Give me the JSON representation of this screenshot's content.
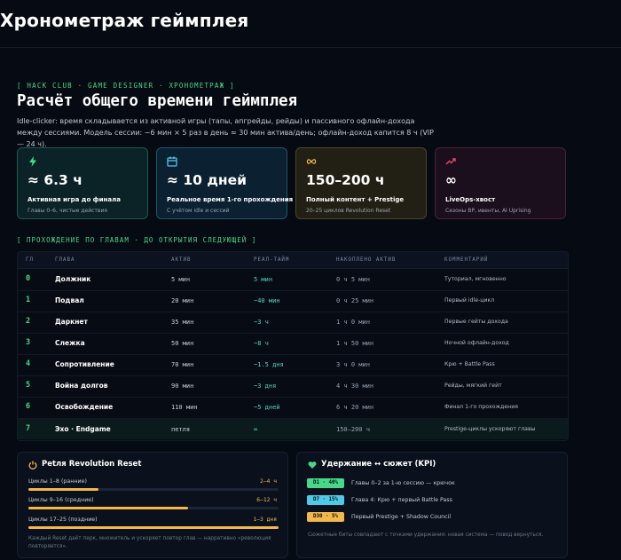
{
  "page_title": "Хронометраж геймплея",
  "eyebrow": "[ HACK CLUB · GAME DESIGNER · ХРОНОМЕТРАЖ ]",
  "title": "Расчёт общего времени геймплея",
  "intro": "Idle-clicker: время складывается из активной игры (тапы, апгрейды, рейды) и пассивного офлайн-дохода между сессиями. Модель сессии: ~6 мин × 5 раз в день ≈ 30 мин актива/день; офлайн-доход капится 8 ч (VIP — 24 ч).",
  "stats": [
    {
      "icon": "lightning-icon",
      "value": "≈ 6.3 ч",
      "label": "Активная игра до финала",
      "sub": "Главы 0–6, чистые действия",
      "accent": "#46d98a"
    },
    {
      "icon": "calendar-icon",
      "value": "≈ 10 дней",
      "label": "Реальное время 1-го прохождения",
      "sub": "С учётом idle и сессий",
      "accent": "#4fc9e6"
    },
    {
      "icon": "infinity-icon",
      "value": "150–200 ч",
      "label": "Полный контент + Prestige",
      "sub": "20–25 циклов Revolution Reset",
      "accent": "#f2b84b"
    },
    {
      "icon": "trending-up-icon",
      "value": "∞",
      "label": "LiveOps-хвост",
      "sub": "Сезоны BP, ивенты, AI Uprising",
      "accent": "#e8456b"
    }
  ],
  "section_label": "[ ПРОХОЖДЕНИЕ ПО ГЛАВАМ · ДО ОТКРЫТИЯ СЛЕДУЮЩЕЙ ]",
  "table": {
    "headers": [
      "ГЛ",
      "ГЛАВА",
      "АКТИВ",
      "РЕАЛ-ТАЙМ",
      "НАКОПЛЕНО АКТИВ",
      "КОММЕНТАРИЙ"
    ],
    "rows": [
      {
        "num": "0",
        "chapter": "Должник",
        "active": "5 мин",
        "realtime": "5 мин",
        "accum": "0 ч 5 мин",
        "comment": "Туториал, мгновенно"
      },
      {
        "num": "1",
        "chapter": "Подвал",
        "active": "20 мин",
        "realtime": "~40 мин",
        "accum": "0 ч 25 мин",
        "comment": "Первый idle-цикл"
      },
      {
        "num": "2",
        "chapter": "Даркнет",
        "active": "35 мин",
        "realtime": "~3 ч",
        "accum": "1 ч 0 мин",
        "comment": "Первые гейты дохода"
      },
      {
        "num": "3",
        "chapter": "Слежка",
        "active": "50 мин",
        "realtime": "~8 ч",
        "accum": "1 ч 50 мин",
        "comment": "Ночной офлайн-доход"
      },
      {
        "num": "4",
        "chapter": "Сопротивление",
        "active": "70 мин",
        "realtime": "~1.5 дня",
        "accum": "3 ч 0 мин",
        "comment": "Крю + Battle Pass"
      },
      {
        "num": "5",
        "chapter": "Война долгов",
        "active": "90 мин",
        "realtime": "~3 дня",
        "accum": "4 ч 30 мин",
        "comment": "Рейды, мягкий гейт"
      },
      {
        "num": "6",
        "chapter": "Освобождение",
        "active": "110 мин",
        "realtime": "~5 дней",
        "accum": "6 ч 20 мин",
        "comment": "Финал 1-го прохождения"
      },
      {
        "num": "7",
        "chapter": "Эхо · Endgame",
        "active": "петля",
        "realtime": "∞",
        "accum": "150–200 ч",
        "comment": "Prestige-циклы ускоряют главы"
      }
    ]
  },
  "reset_panel": {
    "icon": "power-icon",
    "title": "Petля Revolution Reset",
    "bars": [
      {
        "label": "Циклы 1–8 (ранние)",
        "value": "2–4 ч",
        "fill": 0.28
      },
      {
        "label": "Циклы 9–16 (средние)",
        "value": "6–12 ч",
        "fill": 0.64
      },
      {
        "label": "Циклы 17–25 (поздние)",
        "value": "1–3 дня",
        "fill": 1.0
      }
    ],
    "note": "Каждый Reset даёт перк, множитель и ускоряет повтор глав — нарративно «революция повторяется»."
  },
  "kpi_panel": {
    "icon": "heart-icon",
    "title": "Удержание ↔ сюжет (KPI)",
    "items": [
      {
        "badge": "D1 · 40%",
        "text": "Главы 0–2 за 1-ю сессию — крючок",
        "color": "#46d98a"
      },
      {
        "badge": "D7 · 15%",
        "text": "Глава 4: Крю + первый Battle Pass",
        "color": "#4fc9e6"
      },
      {
        "badge": "D30 · 5%",
        "text": "Первый Prestige + Shadow Council",
        "color": "#f2b84b"
      }
    ],
    "note": "Сюжетные биты совпадают с точками удержания: новая система — повод вернуться."
  }
}
